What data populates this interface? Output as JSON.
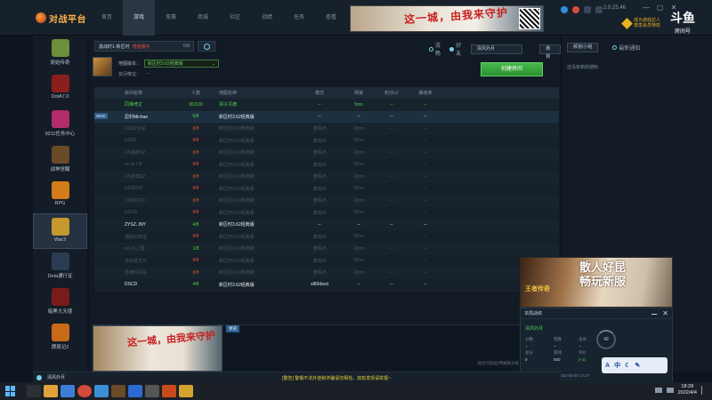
{
  "app": {
    "logo_text": "对战平台",
    "version": "2.0.25.46"
  },
  "topnav": {
    "tabs": [
      "首页",
      "游戏",
      "竞赛",
      "商城",
      "社区",
      "战绩",
      "任务",
      "查看"
    ],
    "banner_text": "这一城，由我来守护",
    "vip_text": [
      "成为游戏达人",
      "尊享会员特权"
    ]
  },
  "douyu": {
    "logo": "斗鱼",
    "room_label": "房间号",
    "room_number": "6929602"
  },
  "sidebar": {
    "items": [
      {
        "label": "原始传奇",
        "icon": "legend-game-icon",
        "color": "#6b8f3a"
      },
      {
        "label": "DotA7.0",
        "icon": "dota-icon",
        "color": "#8a1e1e"
      },
      {
        "label": "9211任务中心",
        "icon": "task-center-icon",
        "color": "#b22b6b"
      },
      {
        "label": "战神觉醒",
        "icon": "war-god-icon",
        "color": "#6b4a2a"
      },
      {
        "label": "RPG",
        "icon": "rpg-icon",
        "color": "#d47b1a"
      },
      {
        "label": "War3",
        "icon": "war3-icon",
        "color": "#c49a2e"
      },
      {
        "label": "Dota通行证",
        "icon": "dota-pass-icon",
        "color": "#2b3c52"
      },
      {
        "label": "暗黑大天使",
        "icon": "dark-angel-icon",
        "color": "#7a1b1b"
      },
      {
        "label": "牌局记2",
        "icon": "card-game-icon",
        "color": "#c86a1a"
      }
    ],
    "active_index": 5
  },
  "room": {
    "name": "激战时1-新区时",
    "status": "增值服务",
    "count": "6/8",
    "map_label": "地图版本：",
    "map_value": "新区时3.62经典版",
    "friend_label": "友间带宝：",
    "friend_value": "--"
  },
  "toolbar": {
    "radios": [
      {
        "label": "流畅",
        "on": false
      },
      {
        "label": "好友",
        "on": true
      }
    ],
    "filter_label": "清风外月",
    "refresh_label": "刷新",
    "create_label": "创建房间"
  },
  "table": {
    "headers": [
      "房间名称",
      "人数",
      "地图名称",
      "模式",
      "网速",
      "积分LV",
      "踢级率"
    ],
    "new_tag": "NEW",
    "rows": [
      {
        "name": "同谁绮丈",
        "count": "95/100",
        "map": "领子贝德",
        "mode": "--",
        "ping": "5ms",
        "lv": "--",
        "rest": "--",
        "style": "green",
        "count_style": "green"
      },
      {
        "name": "忍村Michae",
        "count": "6/8",
        "map": "新区时3.62经典版",
        "mode": "--",
        "ping": "--",
        "lv": "--",
        "rest": "--",
        "style": "white",
        "count_style": "green",
        "selected": true
      },
      {
        "name": "DSSZ全段",
        "count": "8/8",
        "map": "新区时3.62经典版",
        "mode": "激情对",
        "ping": "20ms",
        "lv": "--",
        "rest": "--",
        "style": "dim",
        "count_style": "red"
      },
      {
        "name": "DSSZ",
        "count": "8/8",
        "map": "新区时3.62经典版",
        "mode": "激情对",
        "ping": "20ms",
        "lv": "--",
        "rest": "--",
        "style": "dim",
        "count_style": "red"
      },
      {
        "name": "DS速度SZ",
        "count": "8/8",
        "map": "新区时3.62经典版",
        "mode": "激情对",
        "ping": "20ms",
        "lv": "--",
        "rest": "--",
        "style": "dim",
        "count_style": "red"
      },
      {
        "name": "xz zz | fd",
        "count": "8/8",
        "map": "新区时3.62经典版",
        "mode": "激情对",
        "ping": "20ms",
        "lv": "--",
        "rest": "--",
        "style": "dim",
        "count_style": "red"
      },
      {
        "name": "DS处理SZ",
        "count": "8/8",
        "map": "新区时3.62经典版",
        "mode": "激情对",
        "ping": "20ms",
        "lv": "--",
        "rest": "--",
        "style": "dim",
        "count_style": "red"
      },
      {
        "name": "DSSDSZ",
        "count": "8/8",
        "map": "新区时3.62经典版",
        "mode": "激情对",
        "ping": "20ms",
        "lv": "--",
        "rest": "--",
        "style": "dim",
        "count_style": "red"
      },
      {
        "name": "CDOOOO",
        "count": "8/8",
        "map": "新区时3.62经典版",
        "mode": "激情对",
        "ping": "20ms",
        "lv": "--",
        "rest": "--",
        "style": "dim",
        "count_style": "red"
      },
      {
        "name": "DSCD",
        "count": "8/8",
        "map": "新区时3.62经典版",
        "mode": "激情对",
        "ping": "20ms",
        "lv": "--",
        "rest": "--",
        "style": "dim",
        "count_style": "red"
      },
      {
        "name": "ZYSZ..INY",
        "count": "4/8",
        "map": "新区时3.62经典版",
        "mode": "--",
        "ping": "--",
        "lv": "--",
        "rest": "--",
        "style": "white",
        "count_style": "green"
      },
      {
        "name": "顺颜的转型",
        "count": "8/8",
        "map": "新区时3.62经典版",
        "mode": "激情对",
        "ping": "20ms",
        "lv": "--",
        "rest": "--",
        "style": "dim",
        "count_style": "red"
      },
      {
        "name": "xxx平上国",
        "count": "1/8",
        "map": "新区时3.62经典版",
        "mode": "激情对",
        "ping": "20ms",
        "lv": "--",
        "rest": "--",
        "style": "dim",
        "count_style": "green"
      },
      {
        "name": "自由党员对",
        "count": "8/8",
        "map": "新区时3.62经典版",
        "mode": "激情对",
        "ping": "20ms",
        "lv": "--",
        "rest": "--",
        "style": "dim",
        "count_style": "red"
      },
      {
        "name": "自律时间段",
        "count": "8/8",
        "map": "新区时3.62经典版",
        "mode": "激情对",
        "ping": "20ms",
        "lv": "--",
        "rest": "--",
        "style": "dim",
        "count_style": "red"
      },
      {
        "name": "DSCD",
        "count": "4/8",
        "map": "新区时3.62经典版",
        "mode": "sl60dscd",
        "ping": "--",
        "lv": "--",
        "rest": "--",
        "style": "white",
        "count_style": "green"
      }
    ]
  },
  "chat": {
    "banner_text": "这一城，由我来守护",
    "tab_label": "頻道",
    "hint": "按住可收起/伸展聊天框"
  },
  "right_panel": {
    "tab1": "频道/小组",
    "tab2": "最新通知",
    "notify": "还没有新的通知"
  },
  "ad": {
    "text_line1": "散人好昆",
    "text_line2": "畅玩新服",
    "logo": "王者传奇"
  },
  "info_panel": {
    "title": "本局战绩",
    "room": "清风外月",
    "labels": [
      "分数",
      "得胜",
      "击杀"
    ],
    "values": [
      "--",
      "--",
      "--"
    ],
    "score_labels": [
      "总分",
      "游戏",
      "评价"
    ],
    "score_values": [
      "0",
      "550",
      "(+1)"
    ],
    "gauge": "42",
    "footer": [
      "RPG-新区时",
      "2022-04-04 17:27"
    ]
  },
  "ime": {
    "items": [
      "A",
      "中",
      "☾",
      "✎"
    ]
  },
  "bottom_bar": {
    "name": "清风外月",
    "notice": "[警告] 警惕不法外挂和诈骗请勿相信，如有发现请举报~"
  },
  "taskbar": {
    "time": "18:28",
    "date": "2022/4/4"
  }
}
